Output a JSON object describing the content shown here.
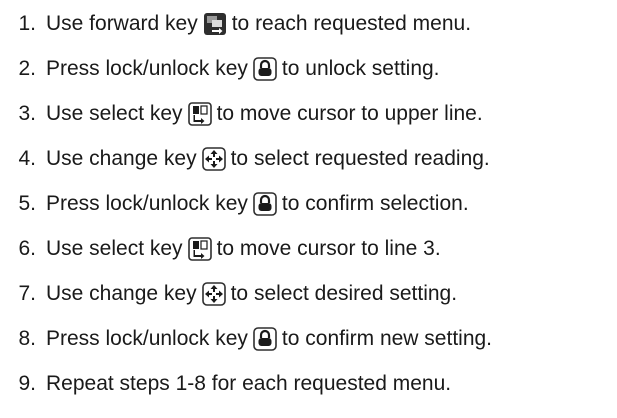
{
  "steps": [
    {
      "number": "1.",
      "before": "Use forward key",
      "icon": "forward-key-icon",
      "after": "to reach requested menu."
    },
    {
      "number": "2.",
      "before": "Press lock/unlock key",
      "icon": "lock-unlock-key-icon",
      "after": "to unlock setting."
    },
    {
      "number": "3.",
      "before": "Use select key",
      "icon": "select-key-icon",
      "after": "to move cursor to upper line."
    },
    {
      "number": "4.",
      "before": "Use change key",
      "icon": "change-key-icon",
      "after": "to select requested reading."
    },
    {
      "number": "5.",
      "before": "Press lock/unlock key",
      "icon": "lock-unlock-key-icon",
      "after": "to confirm selection."
    },
    {
      "number": "6.",
      "before": "Use select key",
      "icon": "select-key-icon",
      "after": "to move cursor to line 3."
    },
    {
      "number": "7.",
      "before": "Use change key",
      "icon": "change-key-icon",
      "after": "to select desired setting."
    },
    {
      "number": "8.",
      "before": "Press lock/unlock key",
      "icon": "lock-unlock-key-icon",
      "after": "to confirm new setting."
    },
    {
      "number": "9.",
      "before": "Repeat steps 1-8 for each requested menu.",
      "icon": null,
      "after": ""
    }
  ]
}
